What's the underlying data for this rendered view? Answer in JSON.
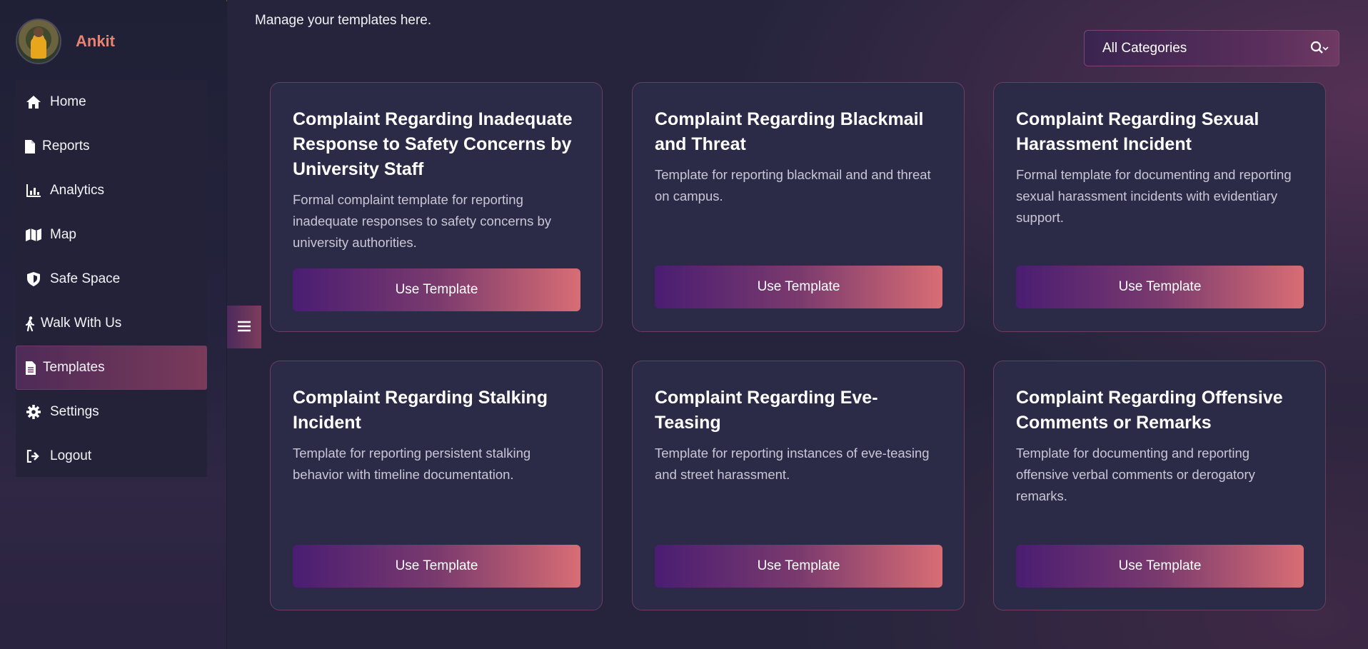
{
  "user": {
    "name": "Ankit"
  },
  "sidebar": {
    "items": [
      {
        "label": "Home",
        "icon": "home-icon"
      },
      {
        "label": "Reports",
        "icon": "file-icon"
      },
      {
        "label": "Analytics",
        "icon": "analytics-icon"
      },
      {
        "label": "Map",
        "icon": "map-icon"
      },
      {
        "label": "Safe Space",
        "icon": "shield-icon"
      },
      {
        "label": "Walk With Us",
        "icon": "walking-icon"
      },
      {
        "label": "Templates",
        "icon": "document-icon",
        "active": true
      },
      {
        "label": "Settings",
        "icon": "gear-icon"
      },
      {
        "label": "Logout",
        "icon": "logout-icon"
      }
    ],
    "toggle_icon": "menu-icon"
  },
  "header": {
    "subtitle": "Manage your templates here."
  },
  "filter": {
    "selected": "All Categories"
  },
  "templates": [
    {
      "title": "Complaint Regarding Inadequate Response to Safety Concerns by University Staff",
      "description": "Formal complaint template for reporting inadequate responses to safety concerns by university authorities.",
      "button": "Use Template"
    },
    {
      "title": "Complaint Regarding Blackmail and Threat",
      "description": "Template for reporting blackmail and and threat on campus.",
      "button": "Use Template"
    },
    {
      "title": "Complaint Regarding Sexual Harassment Incident",
      "description": "Formal template for documenting and reporting sexual harassment incidents with evidentiary support.",
      "button": "Use Template"
    },
    {
      "title": "Complaint Regarding Stalking Incident",
      "description": "Template for reporting persistent stalking behavior with timeline documentation.",
      "button": "Use Template"
    },
    {
      "title": "Complaint Regarding Eve-Teasing",
      "description": "Template for reporting instances of eve-teasing and street harassment.",
      "button": "Use Template"
    },
    {
      "title": "Complaint Regarding Offensive Comments or Remarks",
      "description": "Template for documenting and reporting offensive verbal comments or derogatory remarks.",
      "button": "Use Template"
    }
  ]
}
